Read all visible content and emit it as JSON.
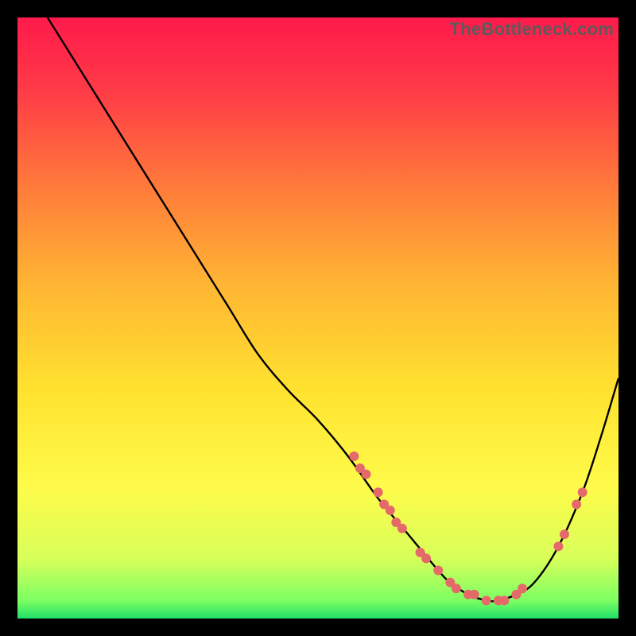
{
  "watermark": "TheBottleneck.com",
  "chart_data": {
    "type": "line",
    "title": "",
    "xlabel": "",
    "ylabel": "",
    "xlim": [
      0,
      100
    ],
    "ylim": [
      0,
      100
    ],
    "grid": false,
    "legend": false,
    "background_gradient": {
      "stops": [
        {
          "offset": 0.0,
          "color": "#ff1a4b"
        },
        {
          "offset": 0.12,
          "color": "#ff3a47"
        },
        {
          "offset": 0.28,
          "color": "#ff7a3a"
        },
        {
          "offset": 0.45,
          "color": "#ffb733"
        },
        {
          "offset": 0.62,
          "color": "#ffe22f"
        },
        {
          "offset": 0.78,
          "color": "#fffb4a"
        },
        {
          "offset": 0.9,
          "color": "#d8ff5a"
        },
        {
          "offset": 0.97,
          "color": "#7dff62"
        },
        {
          "offset": 1.0,
          "color": "#22e06a"
        }
      ]
    },
    "series": [
      {
        "name": "curve",
        "color": "#000000",
        "x": [
          5,
          10,
          15,
          20,
          25,
          30,
          35,
          40,
          45,
          50,
          55,
          60,
          65,
          70,
          72,
          75,
          78,
          80,
          83,
          86,
          90,
          94,
          97,
          100
        ],
        "values": [
          100,
          92,
          84,
          76,
          68,
          60,
          52,
          44,
          38,
          33,
          27,
          20,
          14,
          8,
          6,
          4,
          3,
          3,
          4,
          6,
          12,
          21,
          30,
          40
        ]
      }
    ],
    "markers": {
      "name": "dots",
      "color": "#e46a6a",
      "radius": 6,
      "points": [
        {
          "x": 56,
          "y": 27
        },
        {
          "x": 57,
          "y": 25
        },
        {
          "x": 58,
          "y": 24
        },
        {
          "x": 60,
          "y": 21
        },
        {
          "x": 61,
          "y": 19
        },
        {
          "x": 62,
          "y": 18
        },
        {
          "x": 63,
          "y": 16
        },
        {
          "x": 64,
          "y": 15
        },
        {
          "x": 67,
          "y": 11
        },
        {
          "x": 68,
          "y": 10
        },
        {
          "x": 70,
          "y": 8
        },
        {
          "x": 72,
          "y": 6
        },
        {
          "x": 73,
          "y": 5
        },
        {
          "x": 75,
          "y": 4
        },
        {
          "x": 76,
          "y": 4
        },
        {
          "x": 78,
          "y": 3
        },
        {
          "x": 80,
          "y": 3
        },
        {
          "x": 81,
          "y": 3
        },
        {
          "x": 83,
          "y": 4
        },
        {
          "x": 84,
          "y": 5
        },
        {
          "x": 90,
          "y": 12
        },
        {
          "x": 91,
          "y": 14
        },
        {
          "x": 93,
          "y": 19
        },
        {
          "x": 94,
          "y": 21
        }
      ]
    }
  }
}
